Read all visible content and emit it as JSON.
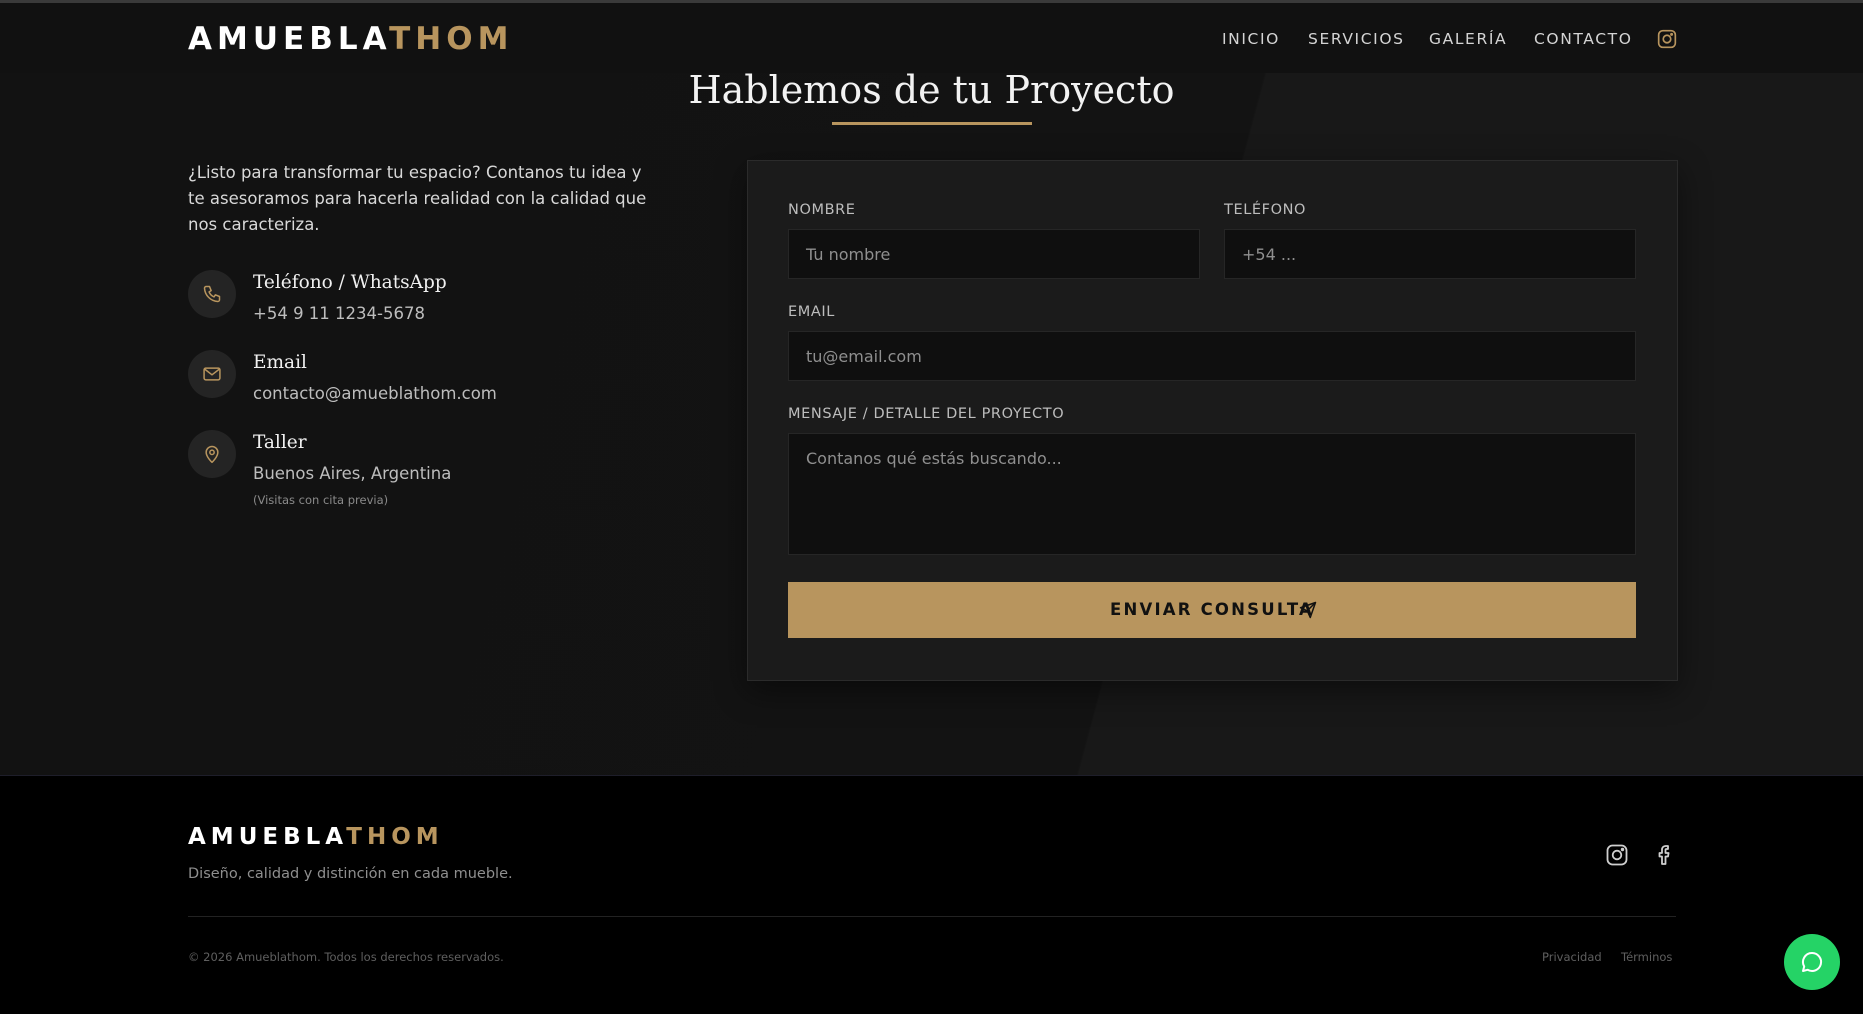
{
  "brand": {
    "logo_part1": "AMUEBLA",
    "logo_part2": "THOM"
  },
  "nav": {
    "items": [
      "INICIO",
      "SERVICIOS",
      "GALERÍA",
      "CONTACTO"
    ],
    "icon": "instagram-icon"
  },
  "contact": {
    "title": "Hablemos de tu Proyecto",
    "intro": "¿Listo para transformar tu espacio? Contanos tu idea y te asesoramos para hacerla realidad con la calidad que nos caracteriza.",
    "items": [
      {
        "icon": "phone-icon",
        "title": "Teléfono / WhatsApp",
        "value": "+54 9 11 1234-5678"
      },
      {
        "icon": "mail-icon",
        "title": "Email",
        "value": "contacto@amueblathom.com"
      },
      {
        "icon": "location-pin-icon",
        "title": "Taller",
        "value": "Buenos Aires, Argentina",
        "note": "(Visitas con cita previa)"
      }
    ]
  },
  "form": {
    "name_label": "NOMBRE",
    "name_placeholder": "Tu nombre",
    "phone_label": "TELÉFONO",
    "phone_placeholder": "+54 ...",
    "email_label": "EMAIL",
    "email_placeholder": "tu@email.com",
    "message_label": "MENSAJE / DETALLE DEL PROYECTO",
    "message_placeholder": "Contanos qué estás buscando...",
    "submit_label": "ENVIAR CONSULTA"
  },
  "footer": {
    "tagline": "Diseño, calidad y distinción en cada mueble.",
    "copyright": "© 2026 Amueblathom. Todos los derechos reservados.",
    "links": [
      "Privacidad",
      "Términos"
    ],
    "social_icons": [
      "instagram-icon",
      "facebook-icon"
    ]
  },
  "colors": {
    "accent": "#b8955e",
    "background": "#141414",
    "whatsapp": "#25d366"
  }
}
